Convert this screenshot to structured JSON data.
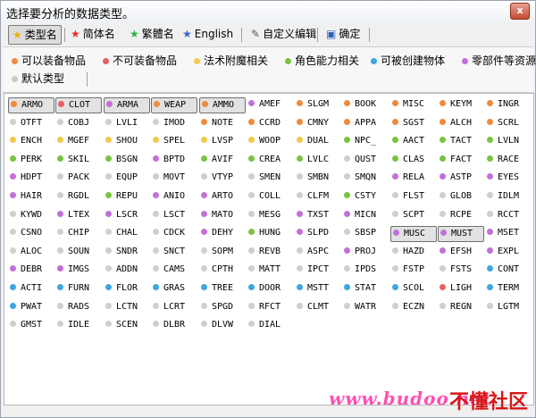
{
  "window": {
    "title": "选择要分析的数据类型。",
    "close_label": "x"
  },
  "toolbar": {
    "buttons": [
      {
        "label": "类型名",
        "icon": "star-icon",
        "color": "#e8b400",
        "active": true
      },
      {
        "label": "简体名",
        "icon": "star-icon",
        "color": "#e0302a",
        "active": false
      },
      {
        "label": "繁體名",
        "icon": "star-icon",
        "color": "#31b043",
        "active": false
      },
      {
        "label": "English",
        "icon": "star-icon",
        "color": "#3a5fd0",
        "active": false
      },
      {
        "label": "自定义编辑",
        "icon": "edit-icon",
        "active": false
      },
      {
        "label": "确定",
        "icon": "save-icon",
        "active": false
      }
    ]
  },
  "filters": [
    {
      "label": "可以装备物品",
      "color": "#f08a3c"
    },
    {
      "label": "不可装备物品",
      "color": "#e86060"
    },
    {
      "label": "法术附魔相关",
      "color": "#f2c94c"
    },
    {
      "label": "角色能力相关",
      "color": "#7cc242"
    },
    {
      "label": "可被创建物体",
      "color": "#3ea6e0"
    },
    {
      "label": "零部件等资源",
      "color": "#c270d8"
    },
    {
      "label": "默认类型",
      "color": "#c8c8c8"
    }
  ],
  "colors": {
    "o": "#f08a3c",
    "r": "#e86060",
    "y": "#f2c94c",
    "g": "#7cc242",
    "b": "#3ea6e0",
    "p": "#c270d8",
    "w": "#cfcfcf"
  },
  "rows": [
    [
      [
        "ARMO",
        "o",
        1
      ],
      [
        "CLOT",
        "r",
        1
      ],
      [
        "ARMA",
        "p",
        1
      ],
      [
        "WEAP",
        "o",
        1
      ],
      [
        "AMMO",
        "o",
        1
      ],
      [
        "AMEF",
        "p",
        0
      ],
      [
        "SLGM",
        "o",
        0
      ],
      [
        "BOOK",
        "o",
        0
      ],
      [
        "MISC",
        "o",
        0
      ],
      [
        "KEYM",
        "o",
        0
      ],
      [
        "INGR",
        "o",
        0
      ]
    ],
    [
      [
        "OTFT",
        "w",
        0
      ],
      [
        "COBJ",
        "w",
        0
      ],
      [
        "LVLI",
        "w",
        0
      ],
      [
        "IMOD",
        "w",
        0
      ],
      [
        "NOTE",
        "o",
        0
      ],
      [
        "CCRD",
        "o",
        0
      ],
      [
        "CMNY",
        "o",
        0
      ],
      [
        "APPA",
        "o",
        0
      ],
      [
        "SGST",
        "o",
        0
      ],
      [
        "ALCH",
        "o",
        0
      ],
      [
        "SCRL",
        "o",
        0
      ]
    ],
    [
      [
        "ENCH",
        "y",
        0
      ],
      [
        "MGEF",
        "y",
        0
      ],
      [
        "SHOU",
        "y",
        0
      ],
      [
        "SPEL",
        "y",
        0
      ],
      [
        "LVSP",
        "y",
        0
      ],
      [
        "WOOP",
        "y",
        0
      ],
      [
        "DUAL",
        "y",
        0
      ],
      [
        "NPC_",
        "g",
        0
      ],
      [
        "AACT",
        "g",
        0
      ],
      [
        "TACT",
        "g",
        0
      ],
      [
        "LVLN",
        "g",
        0
      ]
    ],
    [
      [
        "PERK",
        "g",
        0
      ],
      [
        "SKIL",
        "g",
        0
      ],
      [
        "BSGN",
        "g",
        0
      ],
      [
        "BPTD",
        "p",
        0
      ],
      [
        "AVIF",
        "g",
        0
      ],
      [
        "CREA",
        "g",
        0
      ],
      [
        "LVLC",
        "g",
        0
      ],
      [
        "QUST",
        "w",
        0
      ],
      [
        "CLAS",
        "g",
        0
      ],
      [
        "FACT",
        "g",
        0
      ],
      [
        "RACE",
        "g",
        0
      ]
    ],
    [
      [
        "HDPT",
        "p",
        0
      ],
      [
        "PACK",
        "w",
        0
      ],
      [
        "EQUP",
        "w",
        0
      ],
      [
        "MOVT",
        "w",
        0
      ],
      [
        "VTYP",
        "w",
        0
      ],
      [
        "SMEN",
        "w",
        0
      ],
      [
        "SMBN",
        "w",
        0
      ],
      [
        "SMQN",
        "w",
        0
      ],
      [
        "RELA",
        "p",
        0
      ],
      [
        "ASTP",
        "p",
        0
      ],
      [
        "EYES",
        "p",
        0
      ]
    ],
    [
      [
        "HAIR",
        "p",
        0
      ],
      [
        "RGDL",
        "w",
        0
      ],
      [
        "REPU",
        "g",
        0
      ],
      [
        "ANIO",
        "p",
        0
      ],
      [
        "ARTO",
        "p",
        0
      ],
      [
        "COLL",
        "w",
        0
      ],
      [
        "CLFM",
        "w",
        0
      ],
      [
        "CSTY",
        "g",
        0
      ],
      [
        "FLST",
        "w",
        0
      ],
      [
        "GLOB",
        "w",
        0
      ],
      [
        "IDLM",
        "w",
        0
      ]
    ],
    [
      [
        "KYWD",
        "w",
        0
      ],
      [
        "LTEX",
        "p",
        0
      ],
      [
        "LSCR",
        "p",
        0
      ],
      [
        "LSCT",
        "w",
        0
      ],
      [
        "MATO",
        "p",
        0
      ],
      [
        "MESG",
        "w",
        0
      ],
      [
        "TXST",
        "p",
        0
      ],
      [
        "MICN",
        "p",
        0
      ],
      [
        "SCPT",
        "w",
        0
      ],
      [
        "RCPE",
        "w",
        0
      ],
      [
        "RCCT",
        "w",
        0
      ]
    ],
    [
      [
        "CSNO",
        "w",
        0
      ],
      [
        "CHIP",
        "w",
        0
      ],
      [
        "CHAL",
        "w",
        0
      ],
      [
        "CDCK",
        "w",
        0
      ],
      [
        "DEHY",
        "p",
        0
      ],
      [
        "HUNG",
        "g",
        0
      ],
      [
        "SLPD",
        "p",
        0
      ],
      [
        "SBSP",
        "w",
        0
      ],
      [
        "MUSC",
        "p",
        1
      ],
      [
        "MUST",
        "p",
        1
      ],
      [
        "MSET",
        "p",
        0
      ]
    ],
    [
      [
        "ALOC",
        "w",
        0
      ],
      [
        "SOUN",
        "w",
        0
      ],
      [
        "SNDR",
        "w",
        0
      ],
      [
        "SNCT",
        "w",
        0
      ],
      [
        "SOPM",
        "w",
        0
      ],
      [
        "REVB",
        "w",
        0
      ],
      [
        "ASPC",
        "w",
        0
      ],
      [
        "PROJ",
        "p",
        0
      ],
      [
        "HAZD",
        "w",
        0
      ],
      [
        "EFSH",
        "p",
        0
      ],
      [
        "EXPL",
        "p",
        0
      ]
    ],
    [
      [
        "DEBR",
        "p",
        0
      ],
      [
        "IMGS",
        "p",
        0
      ],
      [
        "ADDN",
        "w",
        0
      ],
      [
        "CAMS",
        "w",
        0
      ],
      [
        "CPTH",
        "w",
        0
      ],
      [
        "MATT",
        "w",
        0
      ],
      [
        "IPCT",
        "w",
        0
      ],
      [
        "IPDS",
        "w",
        0
      ],
      [
        "FSTP",
        "w",
        0
      ],
      [
        "FSTS",
        "w",
        0
      ],
      [
        "CONT",
        "b",
        0
      ]
    ],
    [
      [
        "ACTI",
        "b",
        0
      ],
      [
        "FURN",
        "b",
        0
      ],
      [
        "FLOR",
        "b",
        0
      ],
      [
        "GRAS",
        "b",
        0
      ],
      [
        "TREE",
        "b",
        0
      ],
      [
        "DOOR",
        "b",
        0
      ],
      [
        "MSTT",
        "b",
        0
      ],
      [
        "STAT",
        "b",
        0
      ],
      [
        "SCOL",
        "b",
        0
      ],
      [
        "LIGH",
        "r",
        0
      ],
      [
        "TERM",
        "b",
        0
      ]
    ],
    [
      [
        "PWAT",
        "b",
        0
      ],
      [
        "RADS",
        "w",
        0
      ],
      [
        "LCTN",
        "w",
        0
      ],
      [
        "LCRT",
        "w",
        0
      ],
      [
        "SPGD",
        "w",
        0
      ],
      [
        "RFCT",
        "w",
        0
      ],
      [
        "CLMT",
        "w",
        0
      ],
      [
        "WATR",
        "w",
        0
      ],
      [
        "ECZN",
        "w",
        0
      ],
      [
        "REGN",
        "w",
        0
      ],
      [
        "LGTM",
        "w",
        0
      ]
    ],
    [
      [
        "GMST",
        "w",
        0
      ],
      [
        "IDLE",
        "w",
        0
      ],
      [
        "SCEN",
        "w",
        0
      ],
      [
        "DLBR",
        "w",
        0
      ],
      [
        "DLVW",
        "w",
        0
      ],
      [
        "DIAL",
        "w",
        0
      ]
    ]
  ],
  "watermark": {
    "site": "www.budoo.net",
    "brand": "不懂社区"
  }
}
